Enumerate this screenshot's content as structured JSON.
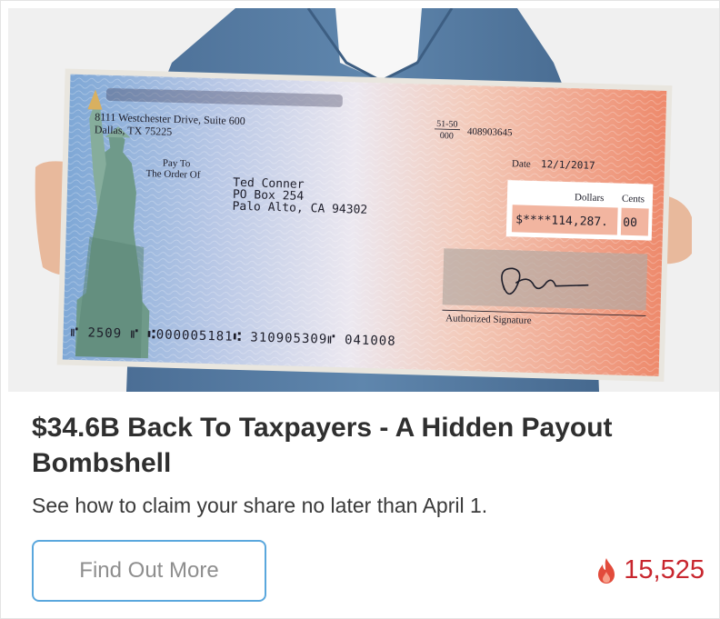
{
  "ad": {
    "headline": "$34.6B Back To Taxpayers - A Hidden Payout Bombshell",
    "subline": "See how to claim your share no later than April 1.",
    "cta_label": "Find Out More",
    "engagement_count": "15,525",
    "engagement_icon": "fire-icon",
    "accent_color": "#c8262e",
    "cta_border_color": "#5aa7dd"
  },
  "check": {
    "address_line1": "8111 Westchester Drive, Suite 600",
    "address_line2": "Dallas, TX 75225",
    "routing_fraction_top": "51-50",
    "routing_fraction_bottom": "000",
    "account_ref": "408903645",
    "date_label": "Date",
    "date_value": "12/1/2017",
    "pay_to_line1": "Pay To",
    "pay_to_line2": "The Order Of",
    "payee_name": "Ted Conner",
    "payee_address1": "PO Box 254",
    "payee_address2": "Palo Alto, CA  94302",
    "dollars_label": "Dollars",
    "cents_label": "Cents",
    "amount": "$****114,287.",
    "cents_value": "00",
    "signature_label": "Authorized Signature",
    "micr_line": "⑈ 2509 ⑈   ⑆000005181⑆  310905309⑈   041008"
  }
}
